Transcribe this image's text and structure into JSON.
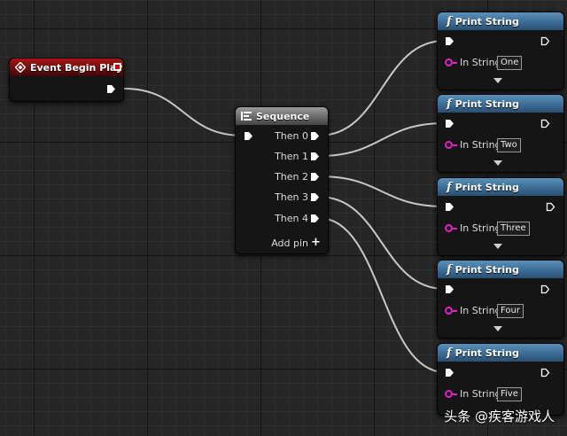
{
  "event_node": {
    "title": "Event Begin Play"
  },
  "sequence_node": {
    "title": "Sequence",
    "outputs": [
      "Then 0",
      "Then 1",
      "Then 2",
      "Then 3",
      "Then 4"
    ],
    "add_pin_label": "Add pin"
  },
  "print_nodes": [
    {
      "title": "Print String",
      "pin_label": "In String",
      "value": "One"
    },
    {
      "title": "Print String",
      "pin_label": "In String",
      "value": "Two"
    },
    {
      "title": "Print String",
      "pin_label": "In String",
      "value": "Three"
    },
    {
      "title": "Print String",
      "pin_label": "In String",
      "value": "Four"
    },
    {
      "title": "Print String",
      "pin_label": "In String",
      "value": "Five"
    }
  ],
  "watermark": "头条 @疾客游戏人",
  "colors": {
    "event_header": "#a51515",
    "sequence_header": "#6a6a6a",
    "function_header": "#3c6c96",
    "string_pin": "#e020c8",
    "wire": "#c8c8c8"
  },
  "icons": {
    "function": "f",
    "event": "diamond-icon",
    "sequence": "sequence-icon",
    "add": "+"
  }
}
